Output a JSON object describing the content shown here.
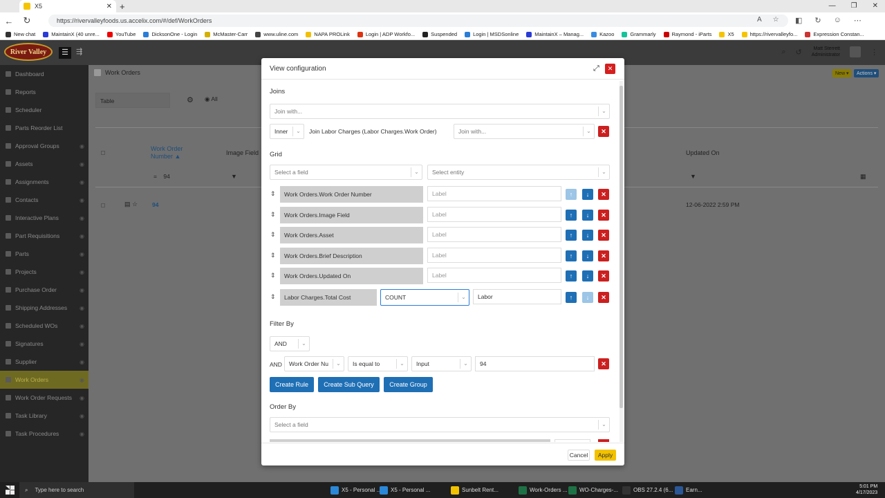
{
  "browser": {
    "tab_title": "X5",
    "url": "https://rivervalleyfoods.us.accelix.com/#/def/WorkOrders",
    "bookmarks": [
      {
        "label": "New chat",
        "color": "#333"
      },
      {
        "label": "MaintainX (40 unre...",
        "color": "#2a3bd6"
      },
      {
        "label": "YouTube",
        "color": "#e00"
      },
      {
        "label": "DicksonOne - Login",
        "color": "#2a7dd6"
      },
      {
        "label": "McMaster-Carr",
        "color": "#d4b000"
      },
      {
        "label": "www.uline.com",
        "color": "#444"
      },
      {
        "label": "NAPA PROLink",
        "color": "#f2c000"
      },
      {
        "label": "Login | ADP Workfo...",
        "color": "#d31"
      },
      {
        "label": "Suspended",
        "color": "#222"
      },
      {
        "label": "Login | MSDSonline",
        "color": "#2a7dd6"
      },
      {
        "label": "MaintainX – Manag...",
        "color": "#2a3bd6"
      },
      {
        "label": "Kazoo",
        "color": "#3a8be0"
      },
      {
        "label": "Grammarly",
        "color": "#15c39a"
      },
      {
        "label": "Raymond - iParts",
        "color": "#c00"
      },
      {
        "label": "X5",
        "color": "#f5c400"
      },
      {
        "label": "https://rivervalleyfo...",
        "color": "#f5c400"
      },
      {
        "label": "Expression Constan...",
        "color": "#c33"
      }
    ]
  },
  "app": {
    "logo_text": "River Valley",
    "user_name": "Matt Sterrett",
    "user_role": "Administrator",
    "sidebar": [
      {
        "label": "Dashboard"
      },
      {
        "label": "Reports"
      },
      {
        "label": "Scheduler"
      },
      {
        "label": "Parts Reorder List"
      },
      {
        "label": "Approval Groups"
      },
      {
        "label": "Assets"
      },
      {
        "label": "Assignments"
      },
      {
        "label": "Contacts"
      },
      {
        "label": "Interactive Plans"
      },
      {
        "label": "Part Requisitions"
      },
      {
        "label": "Parts"
      },
      {
        "label": "Projects"
      },
      {
        "label": "Purchase Order"
      },
      {
        "label": "Shipping Addresses"
      },
      {
        "label": "Scheduled WOs"
      },
      {
        "label": "Signatures"
      },
      {
        "label": "Supplier"
      },
      {
        "label": "Work Orders"
      },
      {
        "label": "Work Order Requests"
      },
      {
        "label": "Task Library"
      },
      {
        "label": "Task Procedures"
      }
    ],
    "page_title": "Work Orders",
    "new_label": "New",
    "actions_label": "Actions",
    "view_mode": "Table",
    "filter_scope": "All",
    "col_work_order_number": "Work Order Number",
    "col_image_field": "Image Field",
    "col_updated_on": "Updated On",
    "filter_value": "94",
    "row_number": "94",
    "row_updated": "12-06-2022 2:59 PM"
  },
  "modal": {
    "title": "View configuration",
    "joins_label": "Joins",
    "join_with_placeholder": "Join with...",
    "join_type": "Inner",
    "join_text": "Join Labor Charges (Labor Charges.Work Order)",
    "grid_label": "Grid",
    "select_field_placeholder": "Select a field",
    "select_entity_placeholder": "Select entity",
    "label_placeholder": "Label",
    "grid_rows": [
      {
        "field": "Work Orders.Work Order Number"
      },
      {
        "field": "Work Orders.Image Field"
      },
      {
        "field": "Work Orders.Asset"
      },
      {
        "field": "Work Orders.Brief Description"
      },
      {
        "field": "Work Orders.Updated On"
      }
    ],
    "agg_row": {
      "field": "Labor Charges.Total Cost",
      "aggregate": "COUNT",
      "label": "Labor"
    },
    "filter_label": "Filter By",
    "filter_conj": "AND",
    "filter_rule": {
      "conj": "AND",
      "field": "Work Order Nu",
      "operator": "Is equal to",
      "type": "Input",
      "value": "94"
    },
    "create_rule": "Create Rule",
    "create_sub_query": "Create Sub Query",
    "create_group": "Create Group",
    "order_label": "Order By",
    "cancel": "Cancel",
    "apply": "Apply"
  },
  "taskbar": {
    "search_placeholder": "Type here to search",
    "items": [
      {
        "label": "X5 - Personal ..."
      },
      {
        "label": "X5 - Personal ..."
      },
      {
        "label": "Sunbelt Rent..."
      },
      {
        "label": "Work-Orders ..."
      },
      {
        "label": "WO-Charges-..."
      },
      {
        "label": "OBS 27.2.4 (6..."
      },
      {
        "label": "Earn..."
      }
    ],
    "time": "5:01 PM",
    "date": "4/17/2023"
  }
}
